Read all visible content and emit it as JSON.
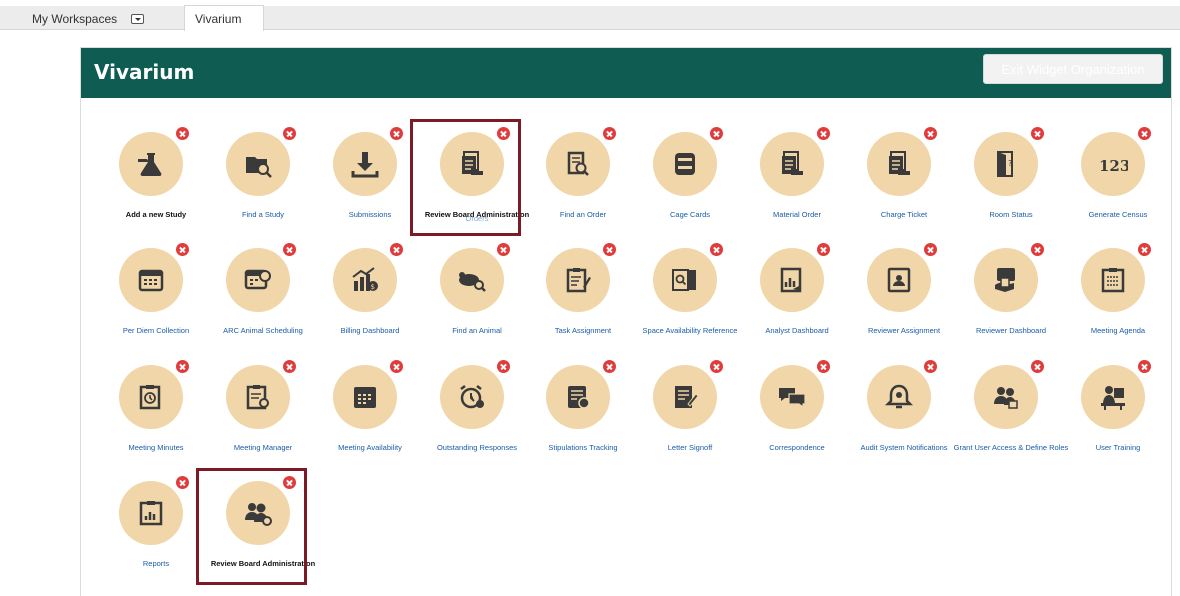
{
  "tabs": {
    "workspaces": "My Workspaces",
    "active": "Vivarium"
  },
  "panel": {
    "title": "Vivarium",
    "exit_button": "Exit Widget Organization"
  },
  "colors": {
    "header": "#0f5c52",
    "tile": "#f0d6a8",
    "icon": "#3a3a3a",
    "remove": "#e03c3c",
    "highlight": "#7c1a26",
    "link": "#1a5ca8"
  },
  "tiles": [
    {
      "label": "Add a new Study",
      "icon": "flask-icon",
      "dark": true
    },
    {
      "label": "Find a Study",
      "icon": "folder-search-icon"
    },
    {
      "label": "Submissions",
      "icon": "download-icon"
    },
    {
      "label": "Review Board Administration",
      "overlay": "Orders",
      "icon": "document-stack-icon",
      "dark": true
    },
    {
      "label": "Find an Order",
      "icon": "document-search-icon"
    },
    {
      "label": "Cage Cards",
      "icon": "card-stack-icon"
    },
    {
      "label": "Material Order",
      "icon": "document-stack-icon"
    },
    {
      "label": "Charge Ticket",
      "icon": "document-stack-icon"
    },
    {
      "label": "Room Status",
      "icon": "door-icon"
    },
    {
      "label": "Generate Census",
      "icon": "numbers-icon"
    },
    {
      "label": "Per Diem Collection",
      "icon": "calendar-icon"
    },
    {
      "label": "ARC Animal Scheduling",
      "icon": "calendar-clock-icon"
    },
    {
      "label": "Billing Dashboard",
      "icon": "chart-dollar-icon"
    },
    {
      "label": "Find an Animal",
      "icon": "mouse-search-icon"
    },
    {
      "label": "Task Assignment",
      "icon": "clipboard-edit-icon"
    },
    {
      "label": "Space Availability Reference",
      "icon": "door-search-icon"
    },
    {
      "label": "Analyst Dashboard",
      "icon": "chart-icon"
    },
    {
      "label": "Reviewer Assignment",
      "icon": "id-badge-icon"
    },
    {
      "label": "Reviewer Dashboard",
      "icon": "hand-card-icon"
    },
    {
      "label": "Meeting Agenda",
      "icon": "clipboard-list-icon"
    },
    {
      "label": "Meeting Minutes",
      "icon": "clipboard-clock-icon"
    },
    {
      "label": "Meeting Manager",
      "icon": "clipboard-gear-icon"
    },
    {
      "label": "Meeting Availability",
      "icon": "calendar-grid-icon"
    },
    {
      "label": "Outstanding Responses",
      "icon": "alarm-clock-icon"
    },
    {
      "label": "Stipulations Tracking",
      "icon": "document-check-icon"
    },
    {
      "label": "Letter Signoff",
      "icon": "document-pen-icon"
    },
    {
      "label": "Correspondence",
      "icon": "chat-bubbles-icon"
    },
    {
      "label": "Audit System Notifications",
      "icon": "bell-icon"
    },
    {
      "label": "Grant User Access & Define Roles",
      "icon": "users-lock-icon"
    },
    {
      "label": "User Training",
      "icon": "desk-user-icon"
    },
    {
      "label": "Reports",
      "icon": "clipboard-chart-icon"
    },
    {
      "label": "Review Board Administration",
      "icon": "users-gear-icon",
      "dark": true
    }
  ]
}
